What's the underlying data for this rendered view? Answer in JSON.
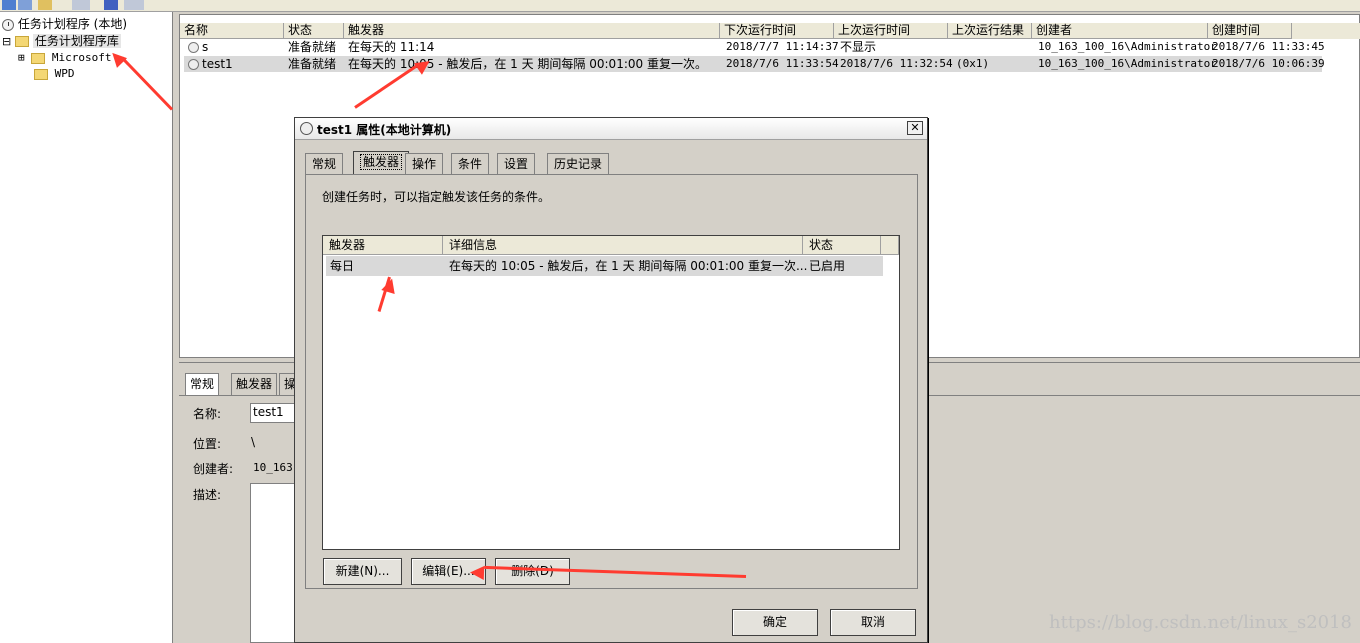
{
  "tree": {
    "root": "任务计划程序 (本地)",
    "library": "任务计划程序库",
    "children": [
      "Microsoft",
      "WPD"
    ],
    "expander": "⊟",
    "child_expander": "⊞"
  },
  "list": {
    "columns": [
      "名称",
      "状态",
      "触发器",
      "下次运行时间",
      "上次运行时间",
      "上次运行结果",
      "创建者",
      "创建时间"
    ],
    "rows": [
      {
        "name": "s",
        "status": "准备就绪",
        "trigger": "在每天的 11:14",
        "next": "2018/7/7 11:14:37",
        "last": "不显示",
        "result": "",
        "author": "10_163_100_16\\Administrator",
        "created": "2018/7/6 11:33:45"
      },
      {
        "name": "test1",
        "status": "准备就绪",
        "trigger": "在每天的 10:05 - 触发后，在 1 天 期间每隔 00:01:00 重复一次。",
        "next": "2018/7/6 11:33:54",
        "last": "2018/7/6 11:32:54",
        "result": "(0x1)",
        "author": "10_163_100_16\\Administrator",
        "created": "2018/7/6 10:06:39"
      }
    ]
  },
  "bottom": {
    "tabs": [
      "常规",
      "触发器",
      "操"
    ],
    "name_label": "名称:",
    "name_value": "test1",
    "location_label": "位置:",
    "location_value": "\\",
    "author_label": "创建者:",
    "author_value": "10_163",
    "desc_label": "描述:"
  },
  "dialog": {
    "title": "test1 属性(本地计算机)",
    "close": "✕",
    "tabs": [
      "常规",
      "触发器",
      "操作",
      "条件",
      "设置",
      "历史记录"
    ],
    "description": "创建任务时，可以指定触发该任务的条件。",
    "trigger_columns": [
      "触发器",
      "详细信息",
      "状态"
    ],
    "trigger_row": {
      "trigger": "每日",
      "details": "在每天的 10:05 - 触发后，在 1 天 期间每隔 00:01:00 重复一次...",
      "status": "已启用"
    },
    "buttons": {
      "new": "新建(N)...",
      "edit": "编辑(E)...",
      "delete": "删除(D)"
    },
    "ok": "确定",
    "cancel": "取消"
  },
  "watermark": "https://blog.csdn.net/linux_s2018",
  "colors": {
    "arrow": "#ff3b30",
    "selection": "#d9d9d9"
  }
}
